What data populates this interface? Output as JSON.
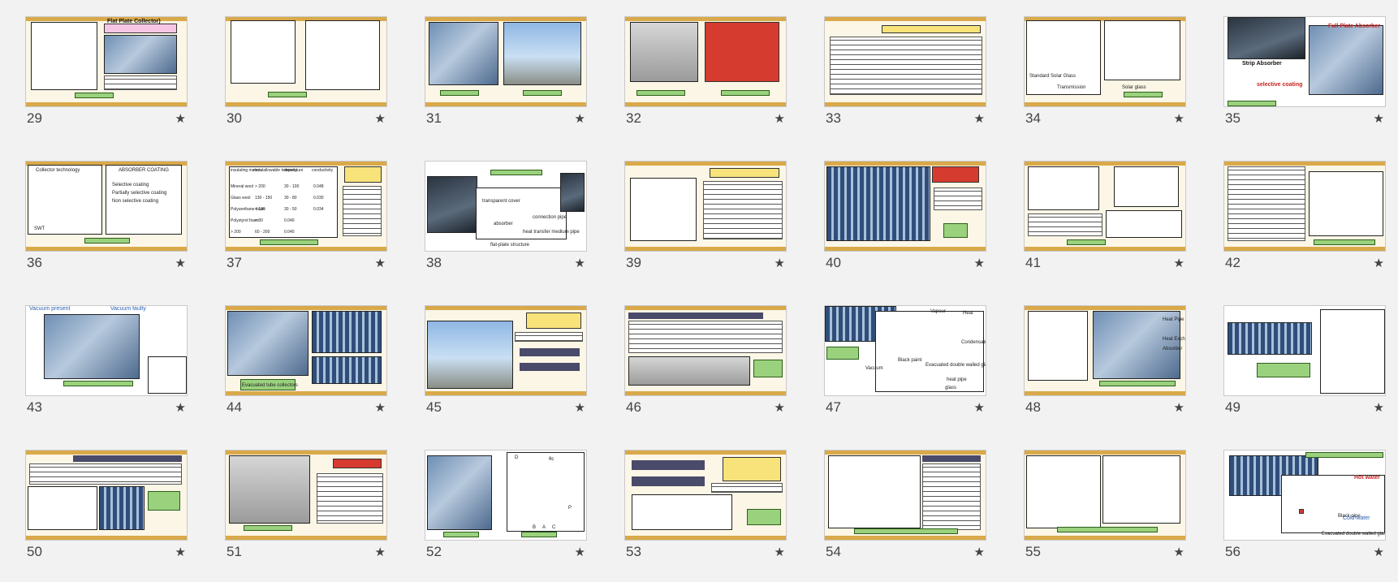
{
  "slides": [
    {
      "number": "29",
      "captions": [
        "Flat Plate Collector)"
      ]
    },
    {
      "number": "30",
      "captions": []
    },
    {
      "number": "31",
      "captions": []
    },
    {
      "number": "32",
      "captions": []
    },
    {
      "number": "33",
      "captions": []
    },
    {
      "number": "34",
      "captions": [
        "Standard Solar Glass",
        "Solar glass",
        "Transmission"
      ]
    },
    {
      "number": "35",
      "captions": [
        "Full Plate Absorber",
        "Strip Absorber",
        "selective coating"
      ]
    },
    {
      "number": "36",
      "captions": [
        "Collector technology",
        "ABSORBER COATING",
        "Selective coating",
        "Partially selective coating",
        "Non selective coating",
        "SWT"
      ]
    },
    {
      "number": "37",
      "captions": [
        "insulating material",
        "max. allowable temperature",
        "density",
        "conductivity",
        "Mineral wool",
        "Glass wool",
        "Polyurethane foam",
        "Polystyrol foam",
        "> 200",
        "> 200",
        "130 - 150",
        "< 130",
        "< 80",
        "60 - 200",
        "30 - 100",
        "30 - 80",
        "30 - 50",
        "0.040",
        "0.040",
        "0.048",
        "0.030",
        "0.034"
      ]
    },
    {
      "number": "38",
      "captions": [
        "transparent cover",
        "absorber",
        "connection pipe",
        "heat transfer medium pipe",
        "flat-plate structure"
      ]
    },
    {
      "number": "39",
      "captions": []
    },
    {
      "number": "40",
      "captions": []
    },
    {
      "number": "41",
      "captions": []
    },
    {
      "number": "42",
      "captions": []
    },
    {
      "number": "43",
      "captions": [
        "Vacuum present",
        "Vacuum faulty"
      ]
    },
    {
      "number": "44",
      "captions": [
        "Evacuated tube collectors"
      ]
    },
    {
      "number": "45",
      "captions": []
    },
    {
      "number": "46",
      "captions": []
    },
    {
      "number": "47",
      "captions": [
        "Vapour",
        "Heat",
        "Condensate",
        "Black paint",
        "Vacuum",
        "Evacuated double walled glass tube",
        "heat pipe",
        "glass"
      ]
    },
    {
      "number": "48",
      "captions": [
        "Heat Pipe",
        "Heat Exchanger",
        "Absorber"
      ]
    },
    {
      "number": "49",
      "captions": []
    },
    {
      "number": "50",
      "captions": []
    },
    {
      "number": "51",
      "captions": []
    },
    {
      "number": "52",
      "captions": [
        "D",
        "θc",
        "B",
        "A",
        "C",
        "P"
      ]
    },
    {
      "number": "53",
      "captions": []
    },
    {
      "number": "54",
      "captions": []
    },
    {
      "number": "55",
      "captions": []
    },
    {
      "number": "56",
      "captions": [
        "Black pipe",
        "Evacuated double walled glass tube",
        "Hot water",
        "Cold water"
      ]
    }
  ],
  "star_icon": "★",
  "icons": {
    "star": "star-icon"
  }
}
